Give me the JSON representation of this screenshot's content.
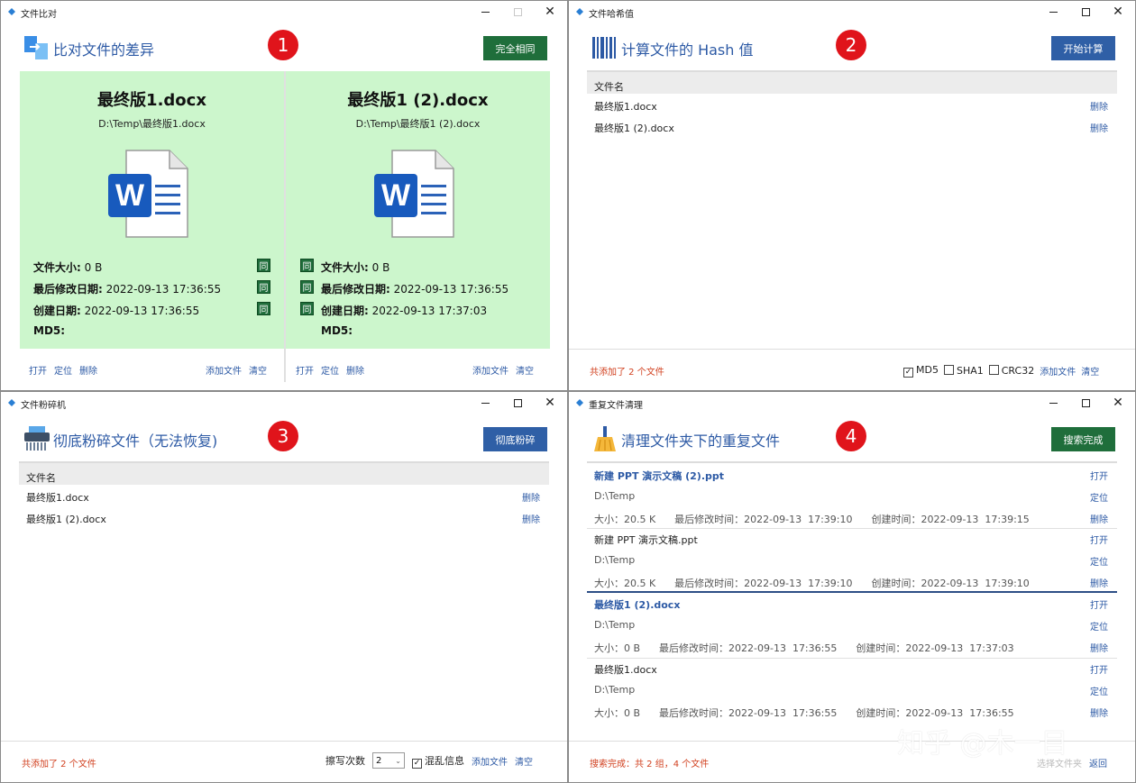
{
  "colors": {
    "accent": "#2d5aa5",
    "green": "#1f6e3b",
    "red": "#e0141b",
    "pane_bg": "#ccf6cc"
  },
  "w1": {
    "title": "文件比对",
    "heading": "比对文件的差异",
    "badge": "1",
    "status_button": "完全相同",
    "same_mark": "同",
    "left": {
      "name": "最终版1.docx",
      "path": "D:\\Temp\\最终版1.docx",
      "size_label": "文件大小:",
      "size": "0 B",
      "mod_label": "最后修改日期:",
      "mod": "2022-09-13  17:36:55",
      "create_label": "创建日期:",
      "create": "2022-09-13  17:36:55",
      "md5_label": "MD5:"
    },
    "right": {
      "name": "最终版1 (2).docx",
      "path": "D:\\Temp\\最终版1 (2).docx",
      "size_label": "文件大小:",
      "size": "0 B",
      "mod_label": "最后修改日期:",
      "mod": "2022-09-13  17:36:55",
      "create_label": "创建日期:",
      "create": "2022-09-13  17:37:03",
      "md5_label": "MD5:"
    },
    "footer": {
      "open": "打开",
      "locate": "定位",
      "delete": "删除",
      "add": "添加文件",
      "clear": "清空"
    }
  },
  "w2": {
    "title": "文件哈希值",
    "heading": "计算文件的 Hash 值",
    "badge": "2",
    "button": "开始计算",
    "col": "文件名",
    "files": [
      "最终版1.docx",
      "最终版1 (2).docx"
    ],
    "delete": "删除",
    "status": "共添加了 2 个文件",
    "opt_md5": "MD5",
    "opt_sha1": "SHA1",
    "opt_crc32": "CRC32",
    "add": "添加文件",
    "clear": "清空"
  },
  "w3": {
    "title": "文件粉碎机",
    "heading": "彻底粉碎文件（无法恢复)",
    "badge": "3",
    "button": "彻底粉碎",
    "col": "文件名",
    "files": [
      "最终版1.docx",
      "最终版1 (2).docx"
    ],
    "delete": "删除",
    "status": "共添加了 2 个文件",
    "passes_label": "擦写次数",
    "passes": "2",
    "scramble": "混乱信息",
    "add": "添加文件",
    "clear": "清空"
  },
  "w4": {
    "title": "重复文件清理",
    "heading": "清理文件夹下的重复文件",
    "badge": "4",
    "button": "搜索完成",
    "open": "打开",
    "locate": "定位",
    "delete": "删除",
    "items": [
      {
        "name": "新建 PPT 演示文稿 (2).ppt",
        "path": "D:\\Temp",
        "meta": "大小：20.5 K      最后修改时间：2022-09-13  17:39:10      创建时间：2022-09-13  17:39:15"
      },
      {
        "name": "新建 PPT 演示文稿.ppt",
        "path": "D:\\Temp",
        "meta": "大小：20.5 K      最后修改时间：2022-09-13  17:39:10      创建时间：2022-09-13  17:39:10"
      },
      {
        "name": "最终版1 (2).docx",
        "path": "D:\\Temp",
        "meta": "大小：0 B      最后修改时间：2022-09-13  17:36:55      创建时间：2022-09-13  17:37:03"
      },
      {
        "name": "最终版1.docx",
        "path": "D:\\Temp",
        "meta": "大小：0 B      最后修改时间：2022-09-13  17:36:55      创建时间：2022-09-13  17:36:55"
      }
    ],
    "status": "搜索完成：共 2 组，4 个文件",
    "select_folder": "选择文件夹",
    "back": "返回"
  },
  "watermark": "知乎 @木一目"
}
